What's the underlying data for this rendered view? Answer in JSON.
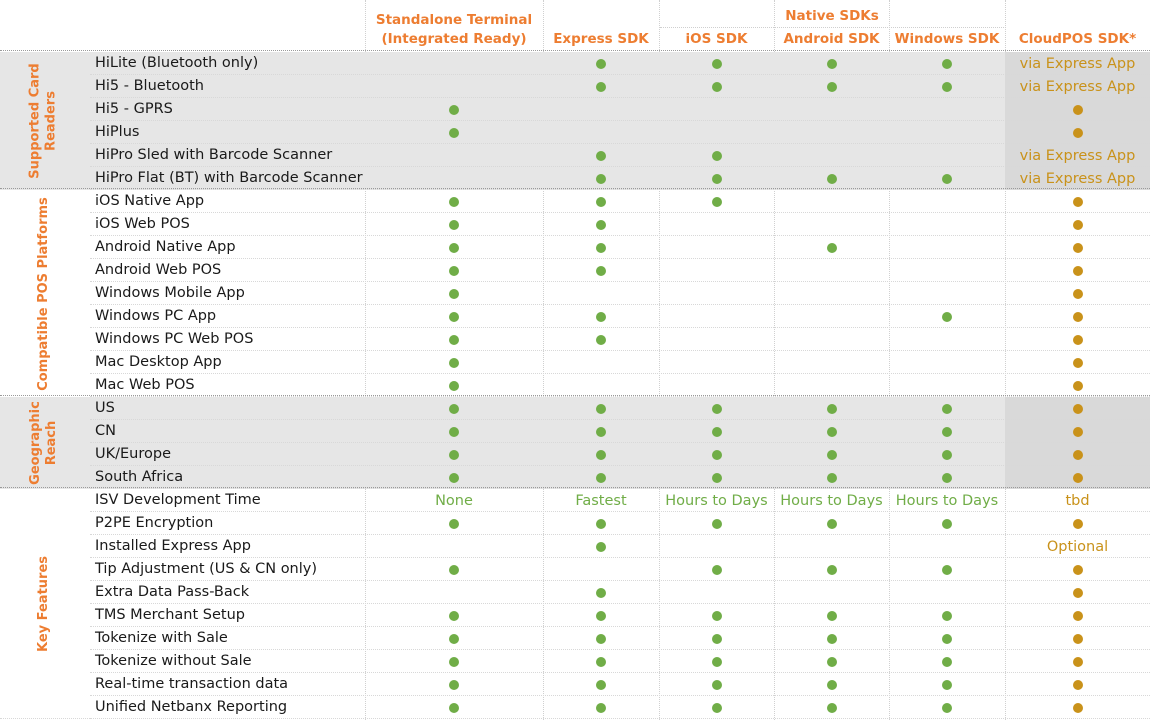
{
  "colors": {
    "green": "#70ad47",
    "gold": "#c9921a",
    "orange": "#ed7d31"
  },
  "header": {
    "native_group": "Native SDKs",
    "columns": [
      {
        "key": "standalone",
        "label_lines": [
          "Standalone Terminal",
          "(Integrated Ready)"
        ]
      },
      {
        "key": "express",
        "label_lines": [
          "Express SDK"
        ]
      },
      {
        "key": "ios",
        "label_lines": [
          "iOS SDK"
        ]
      },
      {
        "key": "android",
        "label_lines": [
          "Android SDK"
        ]
      },
      {
        "key": "windows",
        "label_lines": [
          "Windows SDK"
        ]
      },
      {
        "key": "cloudpos",
        "label_lines": [
          "CloudPOS SDK*"
        ]
      }
    ]
  },
  "sections": [
    {
      "label_lines": [
        "Supported Card",
        "Readers"
      ],
      "shaded": true,
      "rows": [
        {
          "label": "HiLite (Bluetooth only)",
          "cells": [
            "",
            "dot",
            "dot",
            "dot",
            "dot",
            "via Express App"
          ]
        },
        {
          "label": "Hi5 - Bluetooth",
          "cells": [
            "",
            "dot",
            "dot",
            "dot",
            "dot",
            "via Express App"
          ]
        },
        {
          "label": "Hi5 - GPRS",
          "cells": [
            "dot",
            "",
            "",
            "",
            "",
            "dot"
          ]
        },
        {
          "label": "HiPlus",
          "cells": [
            "dot",
            "",
            "",
            "",
            "",
            "dot"
          ]
        },
        {
          "label": "HiPro Sled with Barcode Scanner",
          "cells": [
            "",
            "dot",
            "dot",
            "",
            "",
            "via Express App"
          ]
        },
        {
          "label": "HiPro Flat (BT) with Barcode Scanner",
          "cells": [
            "",
            "dot",
            "dot",
            "dot",
            "dot",
            "via Express App"
          ]
        }
      ]
    },
    {
      "label_lines": [
        "Compatible POS Platforms"
      ],
      "shaded": false,
      "rows": [
        {
          "label": "iOS Native App",
          "cells": [
            "dot",
            "dot",
            "dot",
            "",
            "",
            "dot"
          ]
        },
        {
          "label": "iOS Web POS",
          "cells": [
            "dot",
            "dot",
            "",
            "",
            "",
            "dot"
          ]
        },
        {
          "label": "Android Native App",
          "cells": [
            "dot",
            "dot",
            "",
            "dot",
            "",
            "dot"
          ]
        },
        {
          "label": "Android Web POS",
          "cells": [
            "dot",
            "dot",
            "",
            "",
            "",
            "dot"
          ]
        },
        {
          "label": "Windows Mobile App",
          "cells": [
            "dot",
            "",
            "",
            "",
            "",
            "dot"
          ]
        },
        {
          "label": "Windows PC App",
          "cells": [
            "dot",
            "dot",
            "",
            "",
            "dot",
            "dot"
          ]
        },
        {
          "label": "Windows PC Web POS",
          "cells": [
            "dot",
            "dot",
            "",
            "",
            "",
            "dot"
          ]
        },
        {
          "label": "Mac Desktop App",
          "cells": [
            "dot",
            "",
            "",
            "",
            "",
            "dot"
          ]
        },
        {
          "label": "Mac Web POS",
          "cells": [
            "dot",
            "",
            "",
            "",
            "",
            "dot"
          ]
        }
      ]
    },
    {
      "label_lines": [
        "Geographic",
        "Reach"
      ],
      "shaded": true,
      "rows": [
        {
          "label": "US",
          "cells": [
            "dot",
            "dot",
            "dot",
            "dot",
            "dot",
            "dot"
          ]
        },
        {
          "label": "CN",
          "cells": [
            "dot",
            "dot",
            "dot",
            "dot",
            "dot",
            "dot"
          ]
        },
        {
          "label": "UK/Europe",
          "cells": [
            "dot",
            "dot",
            "dot",
            "dot",
            "dot",
            "dot"
          ]
        },
        {
          "label": "South Africa",
          "cells": [
            "dot",
            "dot",
            "dot",
            "dot",
            "dot",
            "dot"
          ]
        }
      ]
    },
    {
      "label_lines": [
        "Key Features"
      ],
      "shaded": false,
      "rows": [
        {
          "label": "ISV Development Time",
          "cells": [
            "None",
            "Fastest",
            "Hours to Days",
            "Hours to Days",
            "Hours to Days",
            "tbd"
          ]
        },
        {
          "label": "P2PE Encryption",
          "cells": [
            "dot",
            "dot",
            "dot",
            "dot",
            "dot",
            "dot"
          ]
        },
        {
          "label": "Installed Express App",
          "cells": [
            "",
            "dot",
            "",
            "",
            "",
            "Optional"
          ]
        },
        {
          "label": "Tip Adjustment (US & CN only)",
          "cells": [
            "dot",
            "",
            "dot",
            "dot",
            "dot",
            "dot"
          ]
        },
        {
          "label": "Extra Data Pass-Back",
          "cells": [
            "",
            "dot",
            "",
            "",
            "",
            "dot"
          ]
        },
        {
          "label": "TMS Merchant Setup",
          "cells": [
            "dot",
            "dot",
            "dot",
            "dot",
            "dot",
            "dot"
          ]
        },
        {
          "label": "Tokenize with Sale",
          "cells": [
            "dot",
            "dot",
            "dot",
            "dot",
            "dot",
            "dot"
          ]
        },
        {
          "label": "Tokenize without Sale",
          "cells": [
            "dot",
            "dot",
            "dot",
            "dot",
            "dot",
            "dot"
          ]
        },
        {
          "label": "Real-time transaction data",
          "cells": [
            "dot",
            "dot",
            "dot",
            "dot",
            "dot",
            "dot"
          ]
        },
        {
          "label": "Unified Netbanx Reporting",
          "cells": [
            "dot",
            "dot",
            "dot",
            "dot",
            "dot",
            "dot"
          ]
        }
      ]
    }
  ]
}
